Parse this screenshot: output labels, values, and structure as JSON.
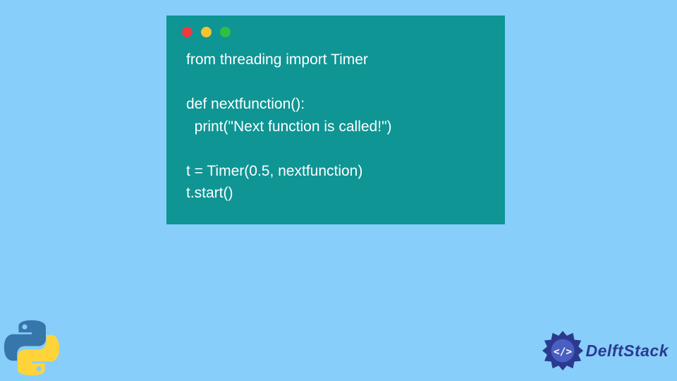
{
  "code": {
    "lines": [
      "from threading import Timer",
      "",
      "def nextfunction():",
      "  print(\"Next function is called!\")",
      "",
      "t = Timer(0.5, nextfunction)",
      "t.start()"
    ]
  },
  "branding": {
    "delft_label": "DelftStack"
  },
  "colors": {
    "page_bg": "#87cefa",
    "window_bg": "#0e9594",
    "code_fg": "#ffffff",
    "dot_red": "#ee3a43",
    "dot_yellow": "#f9c22e",
    "dot_green": "#2fbf44",
    "delft_blue": "#2b3a8f"
  }
}
